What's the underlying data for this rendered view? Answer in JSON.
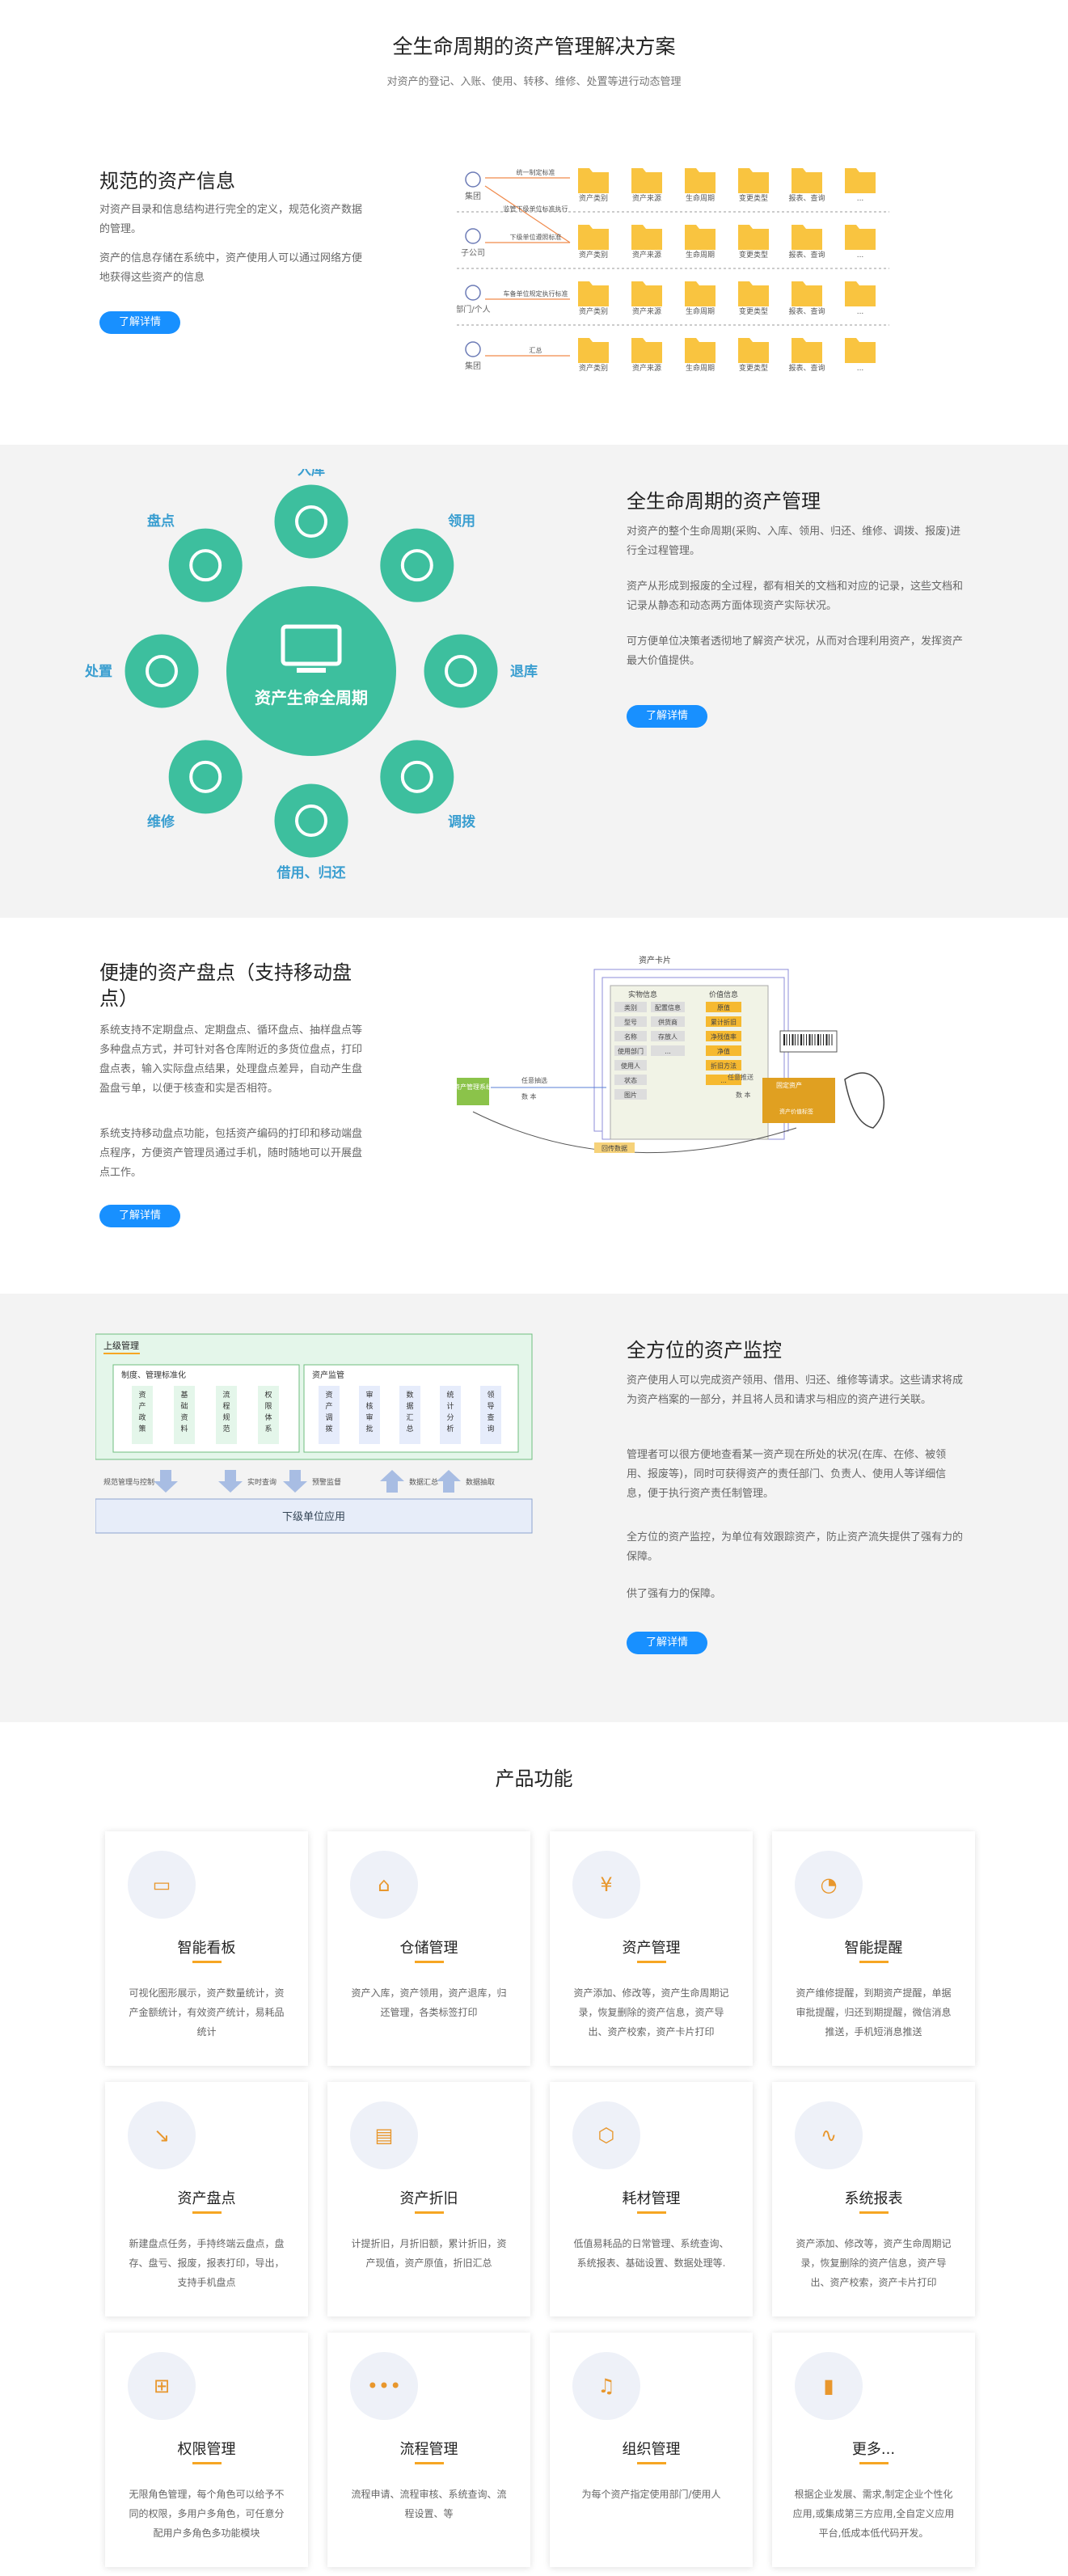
{
  "hero": {
    "title": "全生命周期的资产管理解决方案",
    "subtitle": "对资产的登记、入账、使用、转移、维修、处置等进行动态管理"
  },
  "s1": {
    "title": "规范的资产信息",
    "p1": "对资产目录和信息结构进行完全的定义，规范化资产数据的管理。",
    "p2": "资产的信息存储在系统中，资产使用人可以通过网络方便地获得这些资产的信息",
    "btn": "了解详情",
    "diagram": {
      "rows": [
        "集团",
        "子公司",
        "部门/个人",
        "集团"
      ],
      "arrows": [
        "统一制定标准",
        "监管下级单位标准执行",
        "下级单位遵照标准",
        "车备单位规定执行标准",
        "汇总"
      ],
      "folders": [
        "资产类别",
        "资产来源",
        "生命周期",
        "变更类型",
        "报表、查询",
        "..."
      ]
    }
  },
  "s2": {
    "title": "全生命周期的资产管理",
    "p1": "对资产的整个生命周期(采购、入库、领用、归还、维修、调拨、报废)进行全过程管理。",
    "p2": "资产从形成到报废的全过程，都有相关的文档和对应的记录，这些文档和记录从静态和动态两方面体现资产实际状况。",
    "p3": "可方便单位决策者透彻地了解资产状况，从而对合理利用资产，发挥资产最大价值提供。",
    "btn": "了解详情",
    "center": "资产生命全周期",
    "labels": [
      "入库",
      "领用",
      "退库",
      "调拨",
      "借用、归还",
      "维修",
      "处置",
      "盘点"
    ]
  },
  "s3": {
    "title": "便捷的资产盘点（支持移动盘点）",
    "p1": "系统支持不定期盘点、定期盘点、循环盘点、抽样盘点等多种盘点方式，并可针对各仓库附近的多货位盘点，打印盘点表，输入实际盘点结果，处理盘点差异，自动产生盘盈盘亏单，以便于核查和实是否相符。",
    "p2": "系统支持移动盘点功能，包括资产编码的打印和移动端盘点程序，方便资产管理员通过手机，随时随地可以开展盘点工作。",
    "btn": "了解详情",
    "diagram": {
      "card_title": "资产卡片",
      "col1": "实物信息",
      "col2": "价值信息",
      "sys": "资产管理系统",
      "out": "任意抽选",
      "in": "任意推送",
      "data_a": "数 本",
      "data_b": "数 本",
      "asset": "固定资产",
      "tag": "资产价值标签",
      "upload": "回传数据",
      "col1_items": [
        "类别",
        "型号",
        "名称",
        "使用部门",
        "使用人",
        "状态",
        "图片"
      ],
      "col1_items_b": [
        "配置信息",
        "供货商",
        "存放人",
        "..."
      ],
      "col2_items": [
        "原值",
        "累计折旧",
        "净残值率",
        "净值",
        "折旧方法",
        "..."
      ]
    }
  },
  "s4": {
    "title": "全方位的资产监控",
    "p1": "资产使用人可以完成资产领用、借用、归还、维修等请求。这些请求将成为资产档案的一部分，并且将人员和请求与相应的资产进行关联。",
    "p2": "管理者可以很方便地查看某一资产现在所处的状况(在库、在修、被领用、报废等)，同时可获得资产的责任部门、负责人、使用人等详细信息，便于执行资产责任制管理。",
    "p3": "全方位的资产监控，为单位有效跟踪资产，防止资产流失提供了强有力的保障。",
    "p4": "供了强有力的保障。",
    "btn": "了解详情",
    "diagram": {
      "top": "上级管理",
      "left_title": "制度、管理标准化",
      "right_title": "资产监管",
      "left_cols": [
        "资产政策",
        "基础资料",
        "流程规范",
        "权限体系"
      ],
      "right_cols": [
        "资产调拨",
        "审核审批",
        "数据汇总",
        "统计分析",
        "领导查询"
      ],
      "a1": "规范管理与控制",
      "a2": "实时查询",
      "a3": "预警监督",
      "a4": "数据汇总",
      "a5": "数据抽取",
      "bottom": "下级单位应用"
    }
  },
  "products": {
    "title": "产品功能",
    "items": [
      {
        "name": "智能看板",
        "icon": "dashboard-icon",
        "desc": "可视化图形展示，资产数量统计，资产金额统计，有效资产统计，易耗品统计"
      },
      {
        "name": "仓储管理",
        "icon": "warehouse-icon",
        "desc": "资产入库，资产领用，资产退库，归还管理，各类标签打印"
      },
      {
        "name": "资产管理",
        "icon": "asset-icon",
        "desc": "资产添加、修改等，资产生命周期记录，恢复删除的资产信息，资产导出、资产校索，资产卡片打印"
      },
      {
        "name": "智能提醒",
        "icon": "reminder-icon",
        "desc": "资产维修提醒，到期资产提醒，单据审批提醒，归还到期提醒，微信消息推送，手机短消息推送"
      },
      {
        "name": "资产盘点",
        "icon": "inventory-icon",
        "desc": "新建盘点任务，手持终端云盘点，盘存、盘亏、报废，报表打印，导出，支持手机盘点"
      },
      {
        "name": "资产折旧",
        "icon": "depreciation-icon",
        "desc": "计提折旧，月折旧额，累计折旧，资产现值，资产原值，折旧汇总"
      },
      {
        "name": "耗材管理",
        "icon": "consumable-icon",
        "desc": "低值易耗品的日常管理、系统查询、系统报表、基础设置、数据处理等."
      },
      {
        "name": "系统报表",
        "icon": "report-icon",
        "desc": "资产添加、修改等，资产生命周期记录，恢复删除的资产信息，资产导出、资产校索，资产卡片打印"
      },
      {
        "name": "权限管理",
        "icon": "permission-icon",
        "desc": "无限角色管理，每个角色可以给予不同的权限，多用户多角色，可任意分配用户多角色多功能模块"
      },
      {
        "name": "流程管理",
        "icon": "workflow-icon",
        "desc": "流程申请、流程审核、系统查询、流程设置、等"
      },
      {
        "name": "组织管理",
        "icon": "organization-icon",
        "desc": "为每个资产指定使用部门/使用人"
      },
      {
        "name": "更多...",
        "icon": "more-icon",
        "desc": "根据企业发展、需求,制定企业个性化应用,或集成第三方应用,全自定义应用平台,低成本低代码开发。"
      }
    ]
  },
  "colors": {
    "accent": "#1890ff",
    "teal": "#39b8a2",
    "orange": "#f6a623",
    "gray_bg": "#f3f3f3"
  }
}
